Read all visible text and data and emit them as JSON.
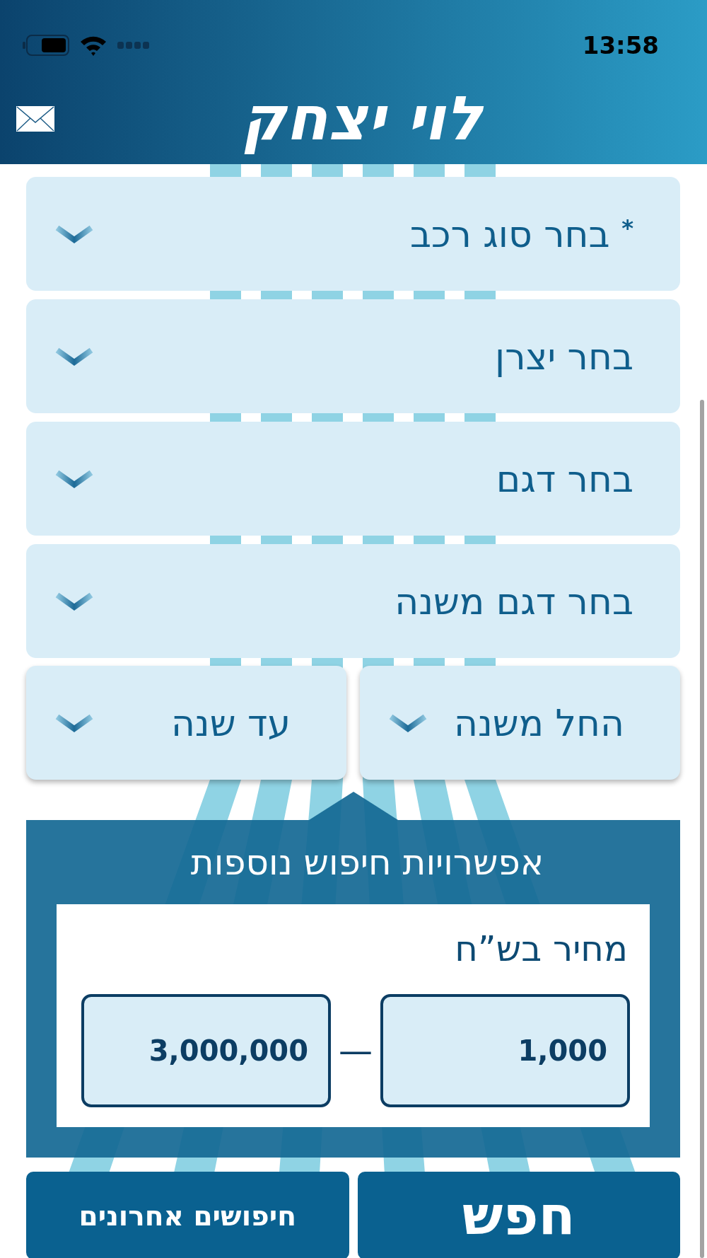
{
  "status_bar": {
    "time": "13:58"
  },
  "header": {
    "logo": "לוי יצחק"
  },
  "dropdowns": [
    {
      "label": "$^{*}$ בחר סוג רכב"
    },
    {
      "label": "בחר יצרן"
    },
    {
      "label": "בחר דגם"
    },
    {
      "label": "בחר דגם משנה"
    }
  ],
  "year_range": [
    {
      "label": "החל משנה"
    },
    {
      "label": "עד שנה"
    }
  ],
  "more_options": {
    "title": "אפשרויות חיפוש נוספות",
    "price": {
      "label": "מחיר בש”ח",
      "min": "1,000",
      "separator": "—",
      "max": "3,000,000"
    }
  },
  "buttons": [
    {
      "kind": "search",
      "label": "חפש"
    },
    {
      "kind": "recent",
      "label": "חיפושים אחרונים"
    }
  ]
}
